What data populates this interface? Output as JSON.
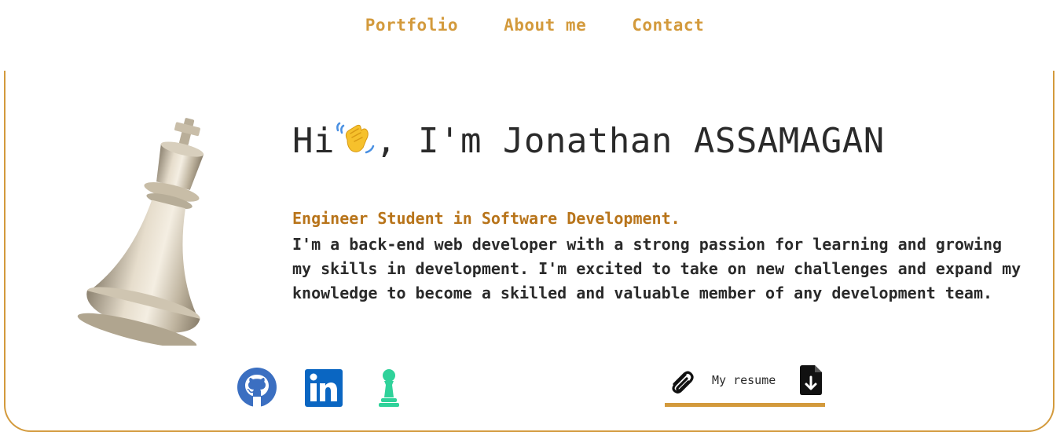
{
  "nav": {
    "items": [
      {
        "label": "Portfolio"
      },
      {
        "label": "About me"
      },
      {
        "label": "Contact"
      }
    ]
  },
  "hero": {
    "greeting_before": "Hi",
    "greeting_after": ", I'm Jonathan ASSAMAGAN",
    "wave_icon": "waving-hand-emoji",
    "subtitle": "Engineer Student in Software Development.",
    "bio": "I'm a back-end web developer with a strong passion for learning and growing my skills in development. I'm excited to take on new challenges and expand my knowledge to become a skilled and valuable member of any development team."
  },
  "social": [
    {
      "icon": "github-icon"
    },
    {
      "icon": "linkedin-icon"
    },
    {
      "icon": "chess-pawn-icon"
    }
  ],
  "resume": {
    "label": "My resume",
    "clip_icon": "paperclip-icon",
    "download_icon": "file-download-icon"
  },
  "colors": {
    "accent": "#d39a3c",
    "subtitle": "#b8741a",
    "text": "#2a2a2a",
    "github": "#3b6fc1",
    "linkedin": "#0a66c2",
    "pawn": "#2fd29a"
  }
}
